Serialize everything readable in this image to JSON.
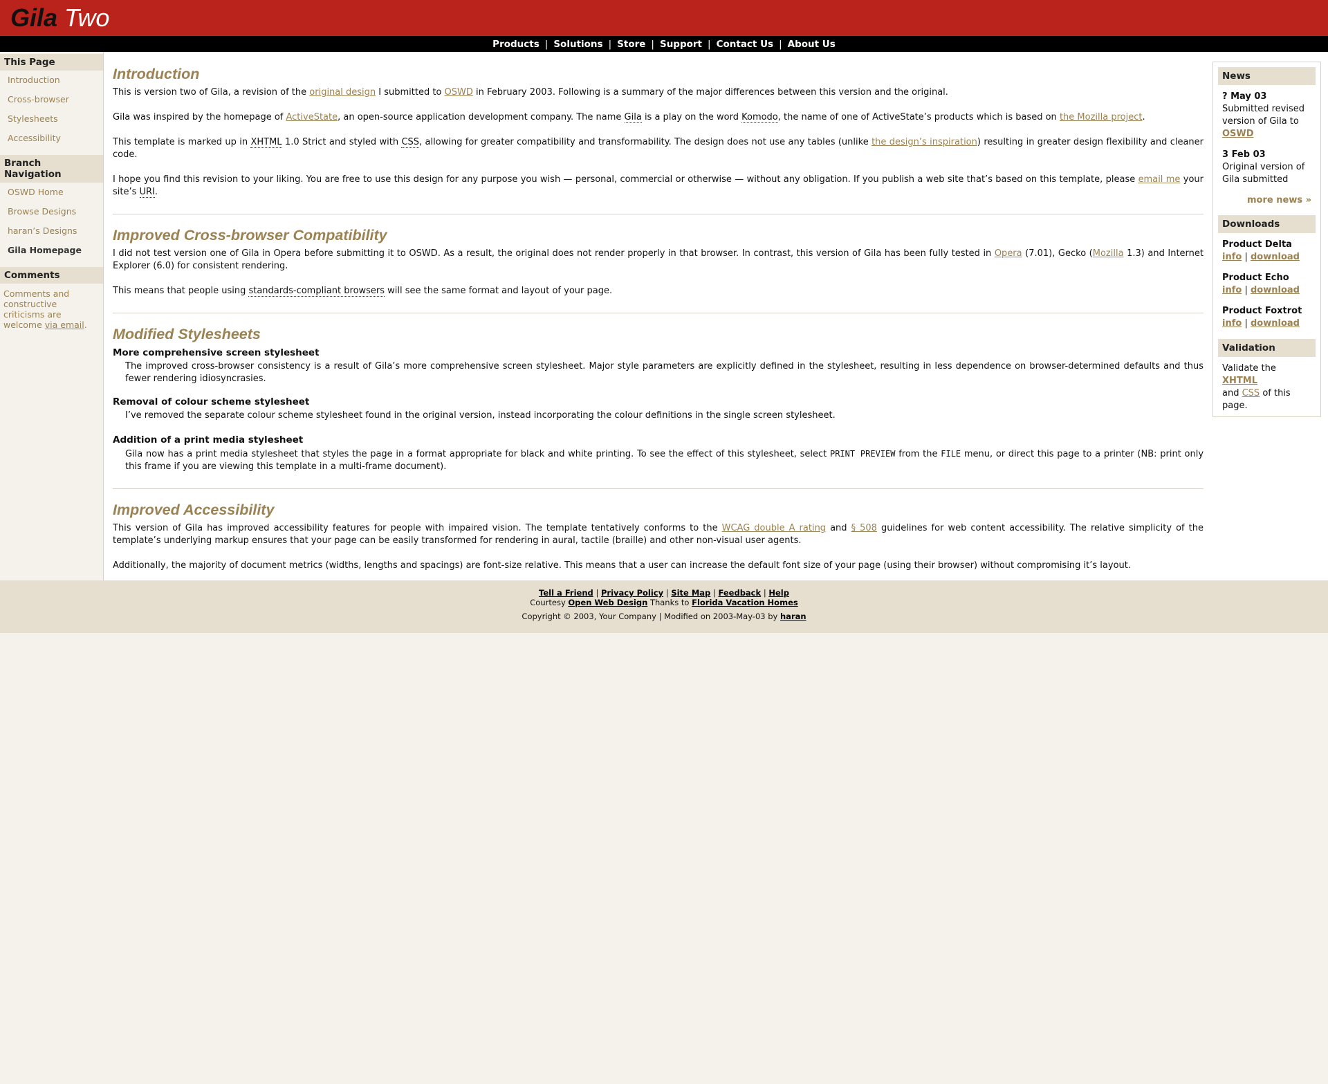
{
  "logo": {
    "part1": "Gila",
    "part2": "Two"
  },
  "topnav": [
    "Products",
    "Solutions",
    "Store",
    "Support",
    "Contact Us",
    "About Us"
  ],
  "left": {
    "this_page_heading": "This Page",
    "this_page": [
      "Introduction",
      "Cross-browser",
      "Stylesheets",
      "Accessibility"
    ],
    "branch_heading": "Branch Navigation",
    "branch": [
      "OSWD Home",
      "Browse Designs",
      "haran’s Designs",
      "Gila Homepage"
    ],
    "comments_heading": "Comments",
    "comments_text": "Comments and constructive criticisms are welcome",
    "comments_link": "via email",
    "comments_end": "."
  },
  "main": {
    "intro": {
      "title": "Introduction",
      "p1": {
        "t1": "This is version two of Gila, a revision of the ",
        "l1": "original design",
        "t2": " I submitted to ",
        "l2": "OSWD",
        "t3": " in February 2003. Following is a summary of the major differences between this version and the original."
      },
      "p2": {
        "t1": "Gila was inspired by the homepage of ",
        "l1": "ActiveState",
        "t2": ", an open-source application development company. The name ",
        "a1": "Gila",
        "t3": " is a play on the word ",
        "a2": "Komodo",
        "t4": ", the name of one of ActiveState’s products which is based on ",
        "l2": "the Mozilla project",
        "t5": "."
      },
      "p3": {
        "t1": "This template is marked up in ",
        "a1": "XHTML",
        "t2": " 1.0 Strict and styled with ",
        "a2": "CSS",
        "t3": ", allowing for greater compatibility and transformability. The design does not use any tables (unlike ",
        "l1": "the design’s inspiration",
        "t4": ") resulting in greater design flexibility and cleaner code."
      },
      "p4": {
        "t1": "I hope you find this revision to your liking. You are free to use this design for any purpose you wish — personal, commercial or otherwise — without any obligation. If you publish a web site that’s based on this template, please ",
        "l1": "email me",
        "t2": " your site’s ",
        "a1": "URI",
        "t3": "."
      }
    },
    "cross": {
      "title": "Improved Cross-browser Compatibility",
      "p1": {
        "t1": "I did not test version one of Gila in Opera before submitting it to OSWD. As a result, the original does not render properly in that browser. In contrast, this version of Gila has been fully tested in ",
        "l1": "Opera",
        "t2": " (7.01), Gecko (",
        "l2": "Mozilla",
        "t3": " 1.3) and Internet Explorer (6.0) for consistent rendering."
      },
      "p2": {
        "t1": "This means that people using ",
        "a1": "standards-compliant browsers",
        "t2": " will see the same format and layout of your page."
      }
    },
    "styles": {
      "title": "Modified Stylesheets",
      "h1": "More comprehensive screen stylesheet",
      "d1": "The improved cross-browser consistency is a result of Gila’s more comprehensive screen stylesheet. Major style parameters are explicitly defined in the stylesheet, resulting in less dependence on browser-determined defaults and thus fewer rendering idiosyncrasies.",
      "h2": "Removal of colour scheme stylesheet",
      "d2": "I’ve removed the separate colour scheme stylesheet found in the original version, instead incorporating the colour definitions in the single screen stylesheet.",
      "h3": "Addition of a print media stylesheet",
      "d3": {
        "t1": "Gila now has a print media stylesheet that styles the page in a format appropriate for black and white printing. To see the effect of this stylesheet, select ",
        "k1": "PRINT PREVIEW",
        "t2": " from the ",
        "k2": "FILE",
        "t3": " menu, or direct this page to a printer (NB: print only this frame if you are viewing this template in a multi-frame document)."
      }
    },
    "access": {
      "title": "Improved Accessibility",
      "p1": {
        "t1": "This version of Gila has improved accessibility features for people with impaired vision. The template tentatively conforms to the ",
        "l1": "WCAG double A rating",
        "t2": " and ",
        "l2": "§ 508",
        "t3": " guidelines for web content accessibility. The relative simplicity of the template’s underlying markup ensures that your page can be easily transformed for rendering in aural, tactile (braille) and other non-visual user agents."
      },
      "p2": "Additionally, the majority of document metrics (widths, lengths and spacings) are font-size relative. This means that a user can increase the default font size of your page (using their browser) without compromising it’s layout."
    }
  },
  "right": {
    "news_heading": "News",
    "news": [
      {
        "date": "? May 03",
        "text": "Submitted revised version of Gila to ",
        "link": "OSWD"
      },
      {
        "date": "3 Feb 03",
        "text": "Original version of Gila submitted",
        "link": ""
      }
    ],
    "more_news": "more news »",
    "downloads_heading": "Downloads",
    "downloads": [
      {
        "name": "Product Delta",
        "info": "info",
        "sep": "|",
        "download": "download"
      },
      {
        "name": "Product Echo",
        "info": "info",
        "sep": "|",
        "download": "download"
      },
      {
        "name": "Product Foxtrot",
        "info": "info",
        "sep": "|",
        "download": "download"
      }
    ],
    "validation_heading": "Validation",
    "validation": {
      "t1": "Validate the ",
      "l1": "XHTML",
      "t2": " and ",
      "l2": "CSS",
      "t3": " of this page."
    }
  },
  "footer": {
    "links": [
      "Tell a Friend",
      "Privacy Policy",
      "Site Map",
      "Feedback",
      "Help"
    ],
    "sep": "|",
    "courtesy": "Courtesy",
    "owd": "Open Web Design",
    "thanks": "Thanks to",
    "fvh": "Florida Vacation Homes",
    "copyright": "Copyright © 2003, Your Company | Modified on 2003-May-03 by",
    "author": "haran"
  }
}
